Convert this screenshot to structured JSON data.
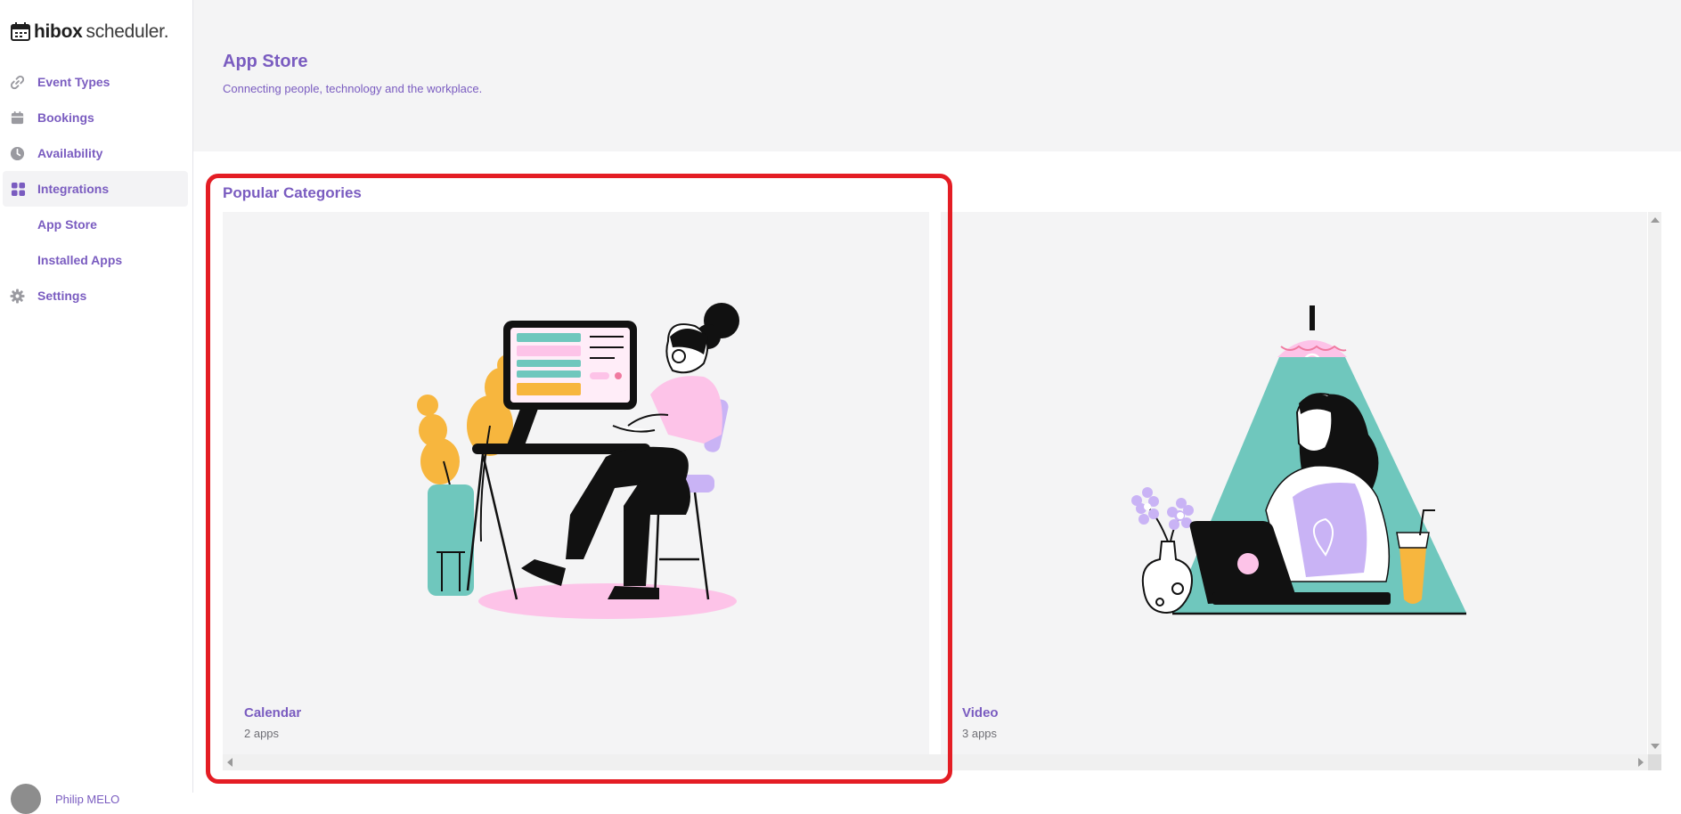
{
  "app": {
    "logo_text_bold": "hibox",
    "logo_text_light": "scheduler."
  },
  "sidebar": {
    "items": [
      {
        "label": "Event Types",
        "icon": "link-icon"
      },
      {
        "label": "Bookings",
        "icon": "calendar-icon"
      },
      {
        "label": "Availability",
        "icon": "clock-icon"
      },
      {
        "label": "Integrations",
        "icon": "grid-icon",
        "active": true
      },
      {
        "label": "App Store",
        "sub": true
      },
      {
        "label": "Installed Apps",
        "sub": true
      },
      {
        "label": "Settings",
        "icon": "gear-icon"
      }
    ],
    "user_name": "Philip MELO"
  },
  "header": {
    "title": "App Store",
    "subtitle": "Connecting people, technology and the workplace."
  },
  "main": {
    "section_title": "Popular Categories",
    "categories": [
      {
        "name": "Calendar",
        "count": "2 apps",
        "illustration": "woman-at-desk-illustration"
      },
      {
        "name": "Video",
        "count": "3 apps",
        "illustration": "woman-with-laptop-illustration"
      }
    ]
  },
  "colors": {
    "accent": "#7a5cc0",
    "highlight": "#e41d24",
    "teal": "#6fc7bd",
    "pink": "#fdc3e8",
    "lavender": "#c9b3f5",
    "orange": "#f7b63e"
  }
}
